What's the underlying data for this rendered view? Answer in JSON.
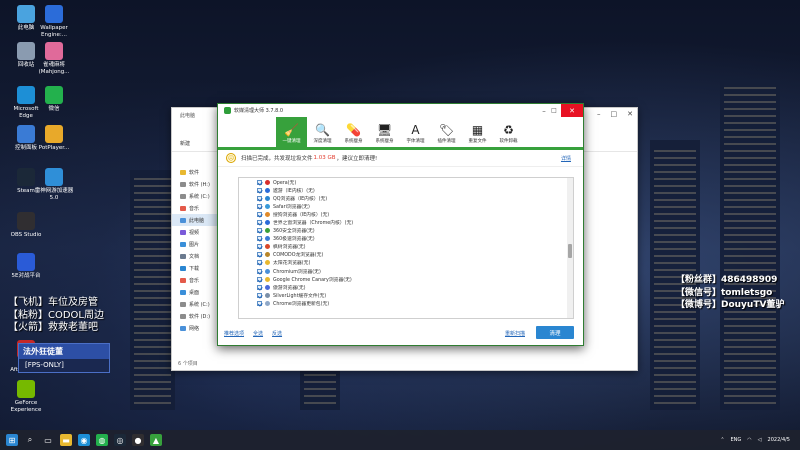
{
  "desktop_icons": [
    {
      "label": "此电脑",
      "icon": "computer-icon",
      "color": "#4aa3df"
    },
    {
      "label": "Wallpaper Engine:...",
      "icon": "wallpaper-engine-icon",
      "color": "#2b6cd9"
    },
    {
      "label": "回收站",
      "icon": "recycle-bin-icon",
      "color": "#8a9bb0"
    },
    {
      "label": "雀魂麻将 (Mahjong...",
      "icon": "mahjong-icon",
      "color": "#e06a9a"
    },
    {
      "label": "Microsoft Edge",
      "icon": "edge-icon",
      "color": "#1d8fd6"
    },
    {
      "label": "微信",
      "icon": "wechat-icon",
      "color": "#23b14d"
    },
    {
      "label": "控制面板",
      "icon": "control-panel-icon",
      "color": "#3a7bd5"
    },
    {
      "label": "PotPlayer...",
      "icon": "potplayer-icon",
      "color": "#e8a92a"
    },
    {
      "label": "Steam",
      "icon": "steam-icon",
      "color": "#1b2838"
    },
    {
      "label": "雷神网游加速器5.0",
      "icon": "accelerator-icon",
      "color": "#2f8fd8"
    },
    {
      "label": "OBS Studio",
      "icon": "obs-icon",
      "color": "#302e31"
    },
    {
      "label": "5E对战平台",
      "icon": "5e-platform-icon",
      "color": "#2a5bd7"
    },
    {
      "label": "MSI Afterburner",
      "icon": "msi-afterburner-icon",
      "color": "#c62828"
    },
    {
      "label": "GeForce Experience",
      "icon": "geforce-icon",
      "color": "#76b900"
    }
  ],
  "explorer": {
    "title": "此电脑",
    "new_label": "新建",
    "sidebar": [
      {
        "label": "软件",
        "color": "#e8b830"
      },
      {
        "label": "软件 (H:)",
        "color": "#8c8c8c"
      },
      {
        "label": "系统 (C:)",
        "color": "#8c8c8c"
      },
      {
        "label": "音乐",
        "color": "#e45a4a"
      },
      {
        "label": "此电脑",
        "color": "#4a90d9"
      },
      {
        "label": "视频",
        "color": "#7a5ad9"
      },
      {
        "label": "图片",
        "color": "#3a8fd9"
      },
      {
        "label": "文档",
        "color": "#6b7a8f"
      },
      {
        "label": "下载",
        "color": "#2a86d1"
      },
      {
        "label": "音乐",
        "color": "#e45a4a"
      },
      {
        "label": "桌面",
        "color": "#3a8fd9"
      },
      {
        "label": "系统 (C:)",
        "color": "#8c8c8c"
      },
      {
        "label": "软件 (D:)",
        "color": "#8c8c8c"
      },
      {
        "label": "网络",
        "color": "#4a90d9"
      }
    ],
    "status": "6 个项目"
  },
  "cleaner": {
    "title": "软媒清理大师 3.7.8.0",
    "tabs": [
      {
        "label": "一键清理",
        "glyph": "🧹",
        "icon": "broom-icon",
        "active": true
      },
      {
        "label": "深度清理",
        "glyph": "🔍",
        "icon": "magnifier-icon",
        "active": false
      },
      {
        "label": "系统瘦身",
        "glyph": "💊",
        "icon": "capsule-icon",
        "active": false
      },
      {
        "label": "系统瘦身",
        "glyph": "🖥",
        "icon": "monitor-icon",
        "active": false
      },
      {
        "label": "字体清理",
        "glyph": "A",
        "icon": "font-icon",
        "active": false
      },
      {
        "label": "插件清理",
        "glyph": "🏷",
        "icon": "plugin-icon",
        "active": false
      },
      {
        "label": "重复文件",
        "glyph": "▦",
        "icon": "grid-icon",
        "active": false
      },
      {
        "label": "软件卸载",
        "glyph": "♻",
        "icon": "uninstall-icon",
        "active": false
      }
    ],
    "banner_prefix": "扫描已完成，共发现垃圾文件",
    "banner_size": "1.03 GB",
    "banner_suffix": "，建议立即清理!",
    "details_link": "详情",
    "items": [
      {
        "label": "Opera(无)",
        "color": "#d62d2d"
      },
      {
        "label": "遨游（IE内核）(无)",
        "color": "#2b6cd9"
      },
      {
        "label": "QQ浏览器（IE内核）(无)",
        "color": "#2a86d1"
      },
      {
        "label": "Safari浏览器(无)",
        "color": "#3a9ad9"
      },
      {
        "label": "搜狗浏览器（IE内核）(无)",
        "color": "#e08a2a"
      },
      {
        "label": "世界之窗浏览器（Chrome内核）(无)",
        "color": "#2a6ad9"
      },
      {
        "label": "360安全浏览器(无)",
        "color": "#3aa03a"
      },
      {
        "label": "360极速浏览器(无)",
        "color": "#3a7bd5"
      },
      {
        "label": "枫树浏览器(无)",
        "color": "#d9482a"
      },
      {
        "label": "COMODO龙浏览器(无)",
        "color": "#b8862a"
      },
      {
        "label": "太阳花浏览器(无)",
        "color": "#e8b830"
      },
      {
        "label": "Chromium浏览器(无)",
        "color": "#4a90d9"
      },
      {
        "label": "Google Chrome Canary浏览器(无)",
        "color": "#e8b830"
      },
      {
        "label": "傲游浏览器(无)",
        "color": "#4a6ad9"
      },
      {
        "label": "SilverLight缓存文件(无)",
        "color": "#7a8fa8"
      },
      {
        "label": "Chrome浏览器更新包(无)",
        "color": "#8fa8c8"
      }
    ],
    "footer_links": [
      "推荐选项",
      "全选",
      "反选"
    ],
    "rescan_label": "重新扫描",
    "clean_label": "清理"
  },
  "overlay_left": [
    "【飞机】车位及房管",
    "【粘粉】CODOL周边",
    "【火箭】救救老董吧"
  ],
  "overlay_tag": {
    "top": "法外狂徒董",
    "bottom": "[FPS-ONLY]"
  },
  "overlay_right": [
    "【粉丝群】486498909",
    "【微信号】tomletsgo",
    "【微博号】DouyuTV董驴"
  ],
  "taskbar": {
    "apps": [
      {
        "icon": "windows-start-icon",
        "glyph": "⊞",
        "color": "#2a86d1"
      },
      {
        "icon": "search-icon",
        "glyph": "⌕",
        "color": "transparent"
      },
      {
        "icon": "task-view-icon",
        "glyph": "▭",
        "color": "transparent"
      },
      {
        "icon": "file-explorer-icon",
        "glyph": "▬",
        "color": "#e8b830"
      },
      {
        "icon": "edge-icon",
        "glyph": "◉",
        "color": "#1d8fd6"
      },
      {
        "icon": "wechat-icon",
        "glyph": "◍",
        "color": "#23b14d"
      },
      {
        "icon": "steam-icon",
        "glyph": "◎",
        "color": "#1b2838"
      },
      {
        "icon": "obs-icon",
        "glyph": "●",
        "color": "#302e31"
      },
      {
        "icon": "cleaner-icon",
        "glyph": "▲",
        "color": "#37a13c"
      }
    ],
    "lang": "ENG",
    "date": "2022/4/5"
  }
}
